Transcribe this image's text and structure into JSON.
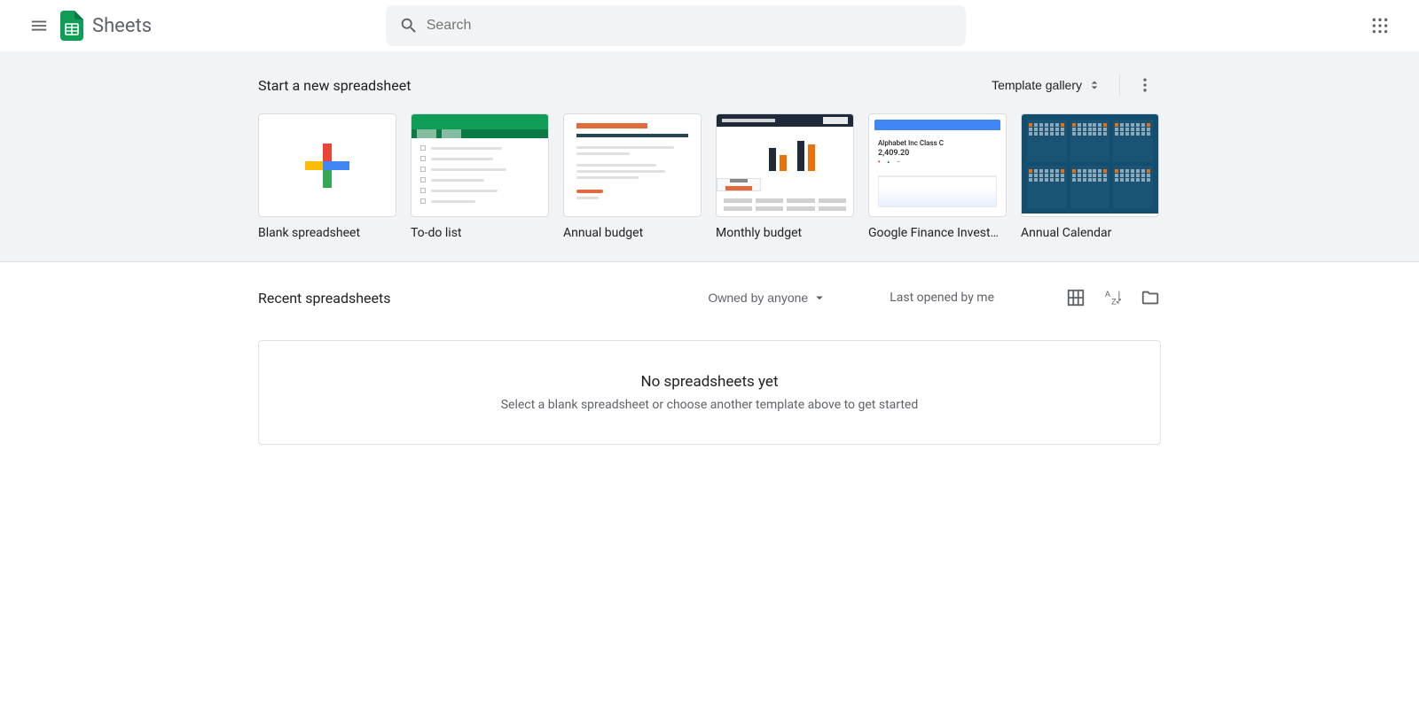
{
  "header": {
    "app_title": "Sheets",
    "search_placeholder": "Search"
  },
  "templates": {
    "heading": "Start a new spreadsheet",
    "gallery_label": "Template gallery",
    "items": [
      {
        "label": "Blank spreadsheet"
      },
      {
        "label": "To-do list"
      },
      {
        "label": "Annual budget"
      },
      {
        "label": "Monthly budget"
      },
      {
        "label": "Google Finance Investment Tracker"
      },
      {
        "label": "Annual Calendar"
      }
    ],
    "finance_preview": {
      "name": "Alphabet Inc Class C",
      "value": "2,409.20"
    }
  },
  "recent": {
    "heading": "Recent spreadsheets",
    "owned_label": "Owned by anyone",
    "last_opened_label": "Last opened by me",
    "empty_title": "No spreadsheets yet",
    "empty_sub": "Select a blank spreadsheet or choose another template above to get started"
  }
}
